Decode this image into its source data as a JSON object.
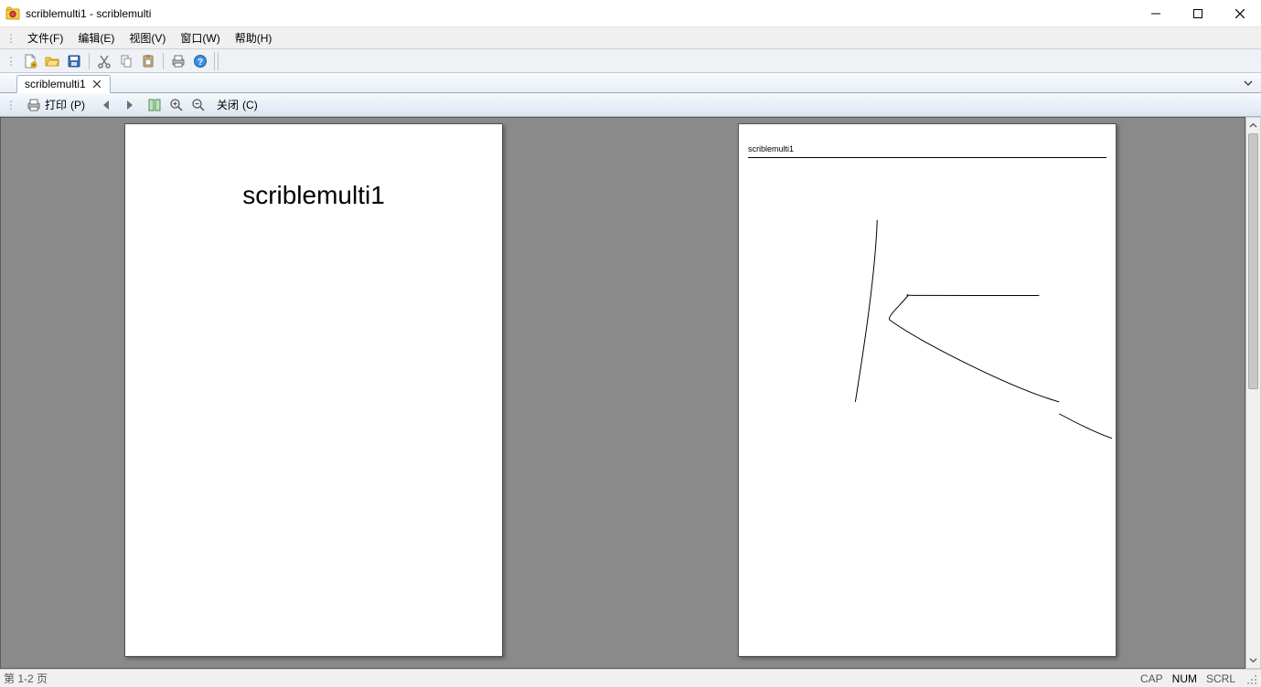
{
  "window": {
    "title": "scriblemulti1 - scriblemulti"
  },
  "menus": {
    "file": {
      "label": "文件",
      "hotkey": "(F)"
    },
    "edit": {
      "label": "编辑",
      "hotkey": "(E)"
    },
    "view": {
      "label": "视图",
      "hotkey": "(V)"
    },
    "window": {
      "label": "窗口",
      "hotkey": "(W)"
    },
    "help": {
      "label": "帮助",
      "hotkey": "(H)"
    }
  },
  "tabs": {
    "active": {
      "label": "scriblemulti1"
    }
  },
  "preview_toolbar": {
    "print": {
      "label": "打印",
      "hotkey": "(P)"
    },
    "close": {
      "label": "关闭",
      "hotkey": "(C)"
    }
  },
  "pages": {
    "page1_title": "scriblemulti1",
    "page2_header": "scriblemulti1"
  },
  "status": {
    "page_info": "第 1-2 页",
    "cap": "CAP",
    "num": "NUM",
    "scrl": "SCRL"
  }
}
